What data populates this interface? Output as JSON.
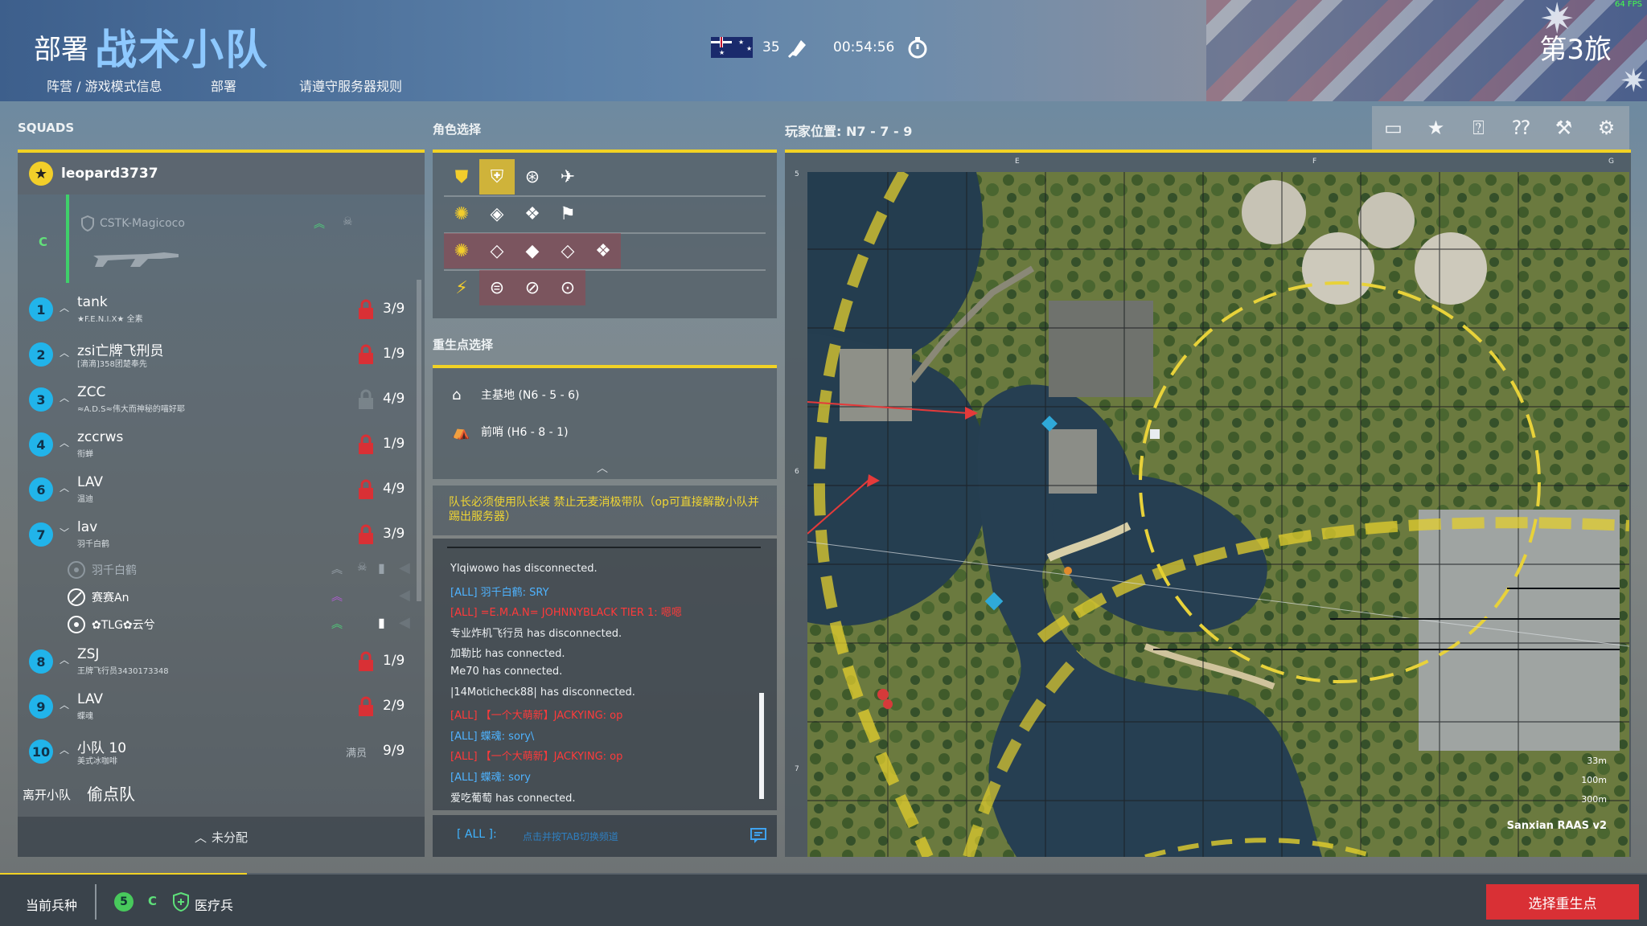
{
  "header": {
    "title_small": "部署",
    "title_big": "战术小队",
    "nav": [
      "阵营 / 游戏模式信息",
      "部署",
      "请遵守服务器规则"
    ],
    "fps": "64 FPS",
    "tickets": "35",
    "timer": "00:54:56",
    "faction": "第3旅"
  },
  "sections": {
    "squads": "SQUADS",
    "role_select": "角色选择",
    "spawn_select": "重生点选择",
    "player_pos": "玩家位置: N7 - 7 - 9"
  },
  "squads": {
    "leader": "leopard3737",
    "current_squad_letter": "C",
    "current_member": "CSTK-Magicoco",
    "list": [
      {
        "num": "1",
        "name": "tank",
        "sub": "★F.E.N.I.X★ 全素",
        "count": "3/9",
        "locked": true
      },
      {
        "num": "2",
        "name": "zsi亡牌飞刑员",
        "sub": "[滴滴]358团楚奉先",
        "count": "1/9",
        "locked": true
      },
      {
        "num": "3",
        "name": "ZCC",
        "sub": "≈A.D.S≈伟大而神秘的喵好耶",
        "count": "4/9",
        "locked": false
      },
      {
        "num": "4",
        "name": "zccrws",
        "sub": "衔蝉",
        "count": "1/9",
        "locked": true
      },
      {
        "num": "6",
        "name": "LAV",
        "sub": "温迪",
        "count": "4/9",
        "locked": true
      },
      {
        "num": "7",
        "name": "lav",
        "sub": "羽千白鹤",
        "count": "3/9",
        "locked": true,
        "expanded": true
      },
      {
        "num": "8",
        "name": "ZSJ",
        "sub": "王牌飞行员3430173348",
        "count": "1/9",
        "locked": true
      },
      {
        "num": "9",
        "name": "LAV",
        "sub": "蝶魂",
        "count": "2/9",
        "locked": true
      },
      {
        "num": "10",
        "name": "小队 10",
        "sub": "美式冰咖啡",
        "count": "9/9",
        "full_label": "满员"
      }
    ],
    "squad7_members": [
      "羽千白鹤",
      "赛赛An",
      "✿TLG✿云兮"
    ],
    "leave_label": "离开小队",
    "squad_name": "偷点队",
    "unassigned": "未分配"
  },
  "spawns": [
    {
      "label": "主基地 (N6 - 5 - 6)",
      "icon": "main-base-icon"
    },
    {
      "label": "前哨 (H6 - 8 - 1)",
      "icon": "outpost-icon"
    }
  ],
  "notice": "队长必须使用队长装  禁止无麦消极带队（op可直接解散小队并踢出服务器）",
  "chat": [
    {
      "text": "Ylqiwowo has disconnected.",
      "kind": "sys"
    },
    {
      "text": "[ALL] 羽千白鹤: SRY",
      "kind": "blue"
    },
    {
      "text": "[ALL] =E.M.A.N= JOHNNYBLACK TIER 1: 嗯嗯",
      "kind": "red"
    },
    {
      "text": "专业炸机飞行员 has disconnected.",
      "kind": "sys"
    },
    {
      "text": "加勒比 has connected.",
      "kind": "sys"
    },
    {
      "text": "Me70 has connected.",
      "kind": "sys"
    },
    {
      "text": "|14Moticheck88| has disconnected.",
      "kind": "sys"
    },
    {
      "text": "[ALL] 【一个大萌新】JACKYING: op",
      "kind": "red"
    },
    {
      "text": "[ALL] 蝶魂: sory\\",
      "kind": "blue"
    },
    {
      "text": "[ALL] 【一个大萌新】JACKYING: op",
      "kind": "red"
    },
    {
      "text": "[ALL] 蝶魂: sory",
      "kind": "blue"
    },
    {
      "text": "爱吃葡萄 has connected.",
      "kind": "sys"
    }
  ],
  "chat_input": {
    "channel": "[ ALL ]:",
    "placeholder": "点击并按TAB切换频道"
  },
  "map": {
    "grid_cols": [
      "E",
      "F",
      "G"
    ],
    "grid_rows": [
      "5",
      "6",
      "7"
    ],
    "scale": [
      "33m",
      "100m",
      "300m"
    ],
    "name": "Sanxian RAAS v2"
  },
  "map_tools": [
    "chat-bubble-icon",
    "star-icon",
    "radio-help-icon",
    "helicopter-help-icon",
    "wrench-icon",
    "gear-icon"
  ],
  "bottom": {
    "current_class_label": "当前兵种",
    "squad_num": "5",
    "squad_letter": "C",
    "role": "医疗兵",
    "spawn_button": "选择重生点",
    "progress": 0.15
  },
  "colors": {
    "accent_yellow": "#f2d224",
    "squad_blue": "#21b4ea",
    "lock_red": "#d93035",
    "spawn_red": "#d93035"
  }
}
